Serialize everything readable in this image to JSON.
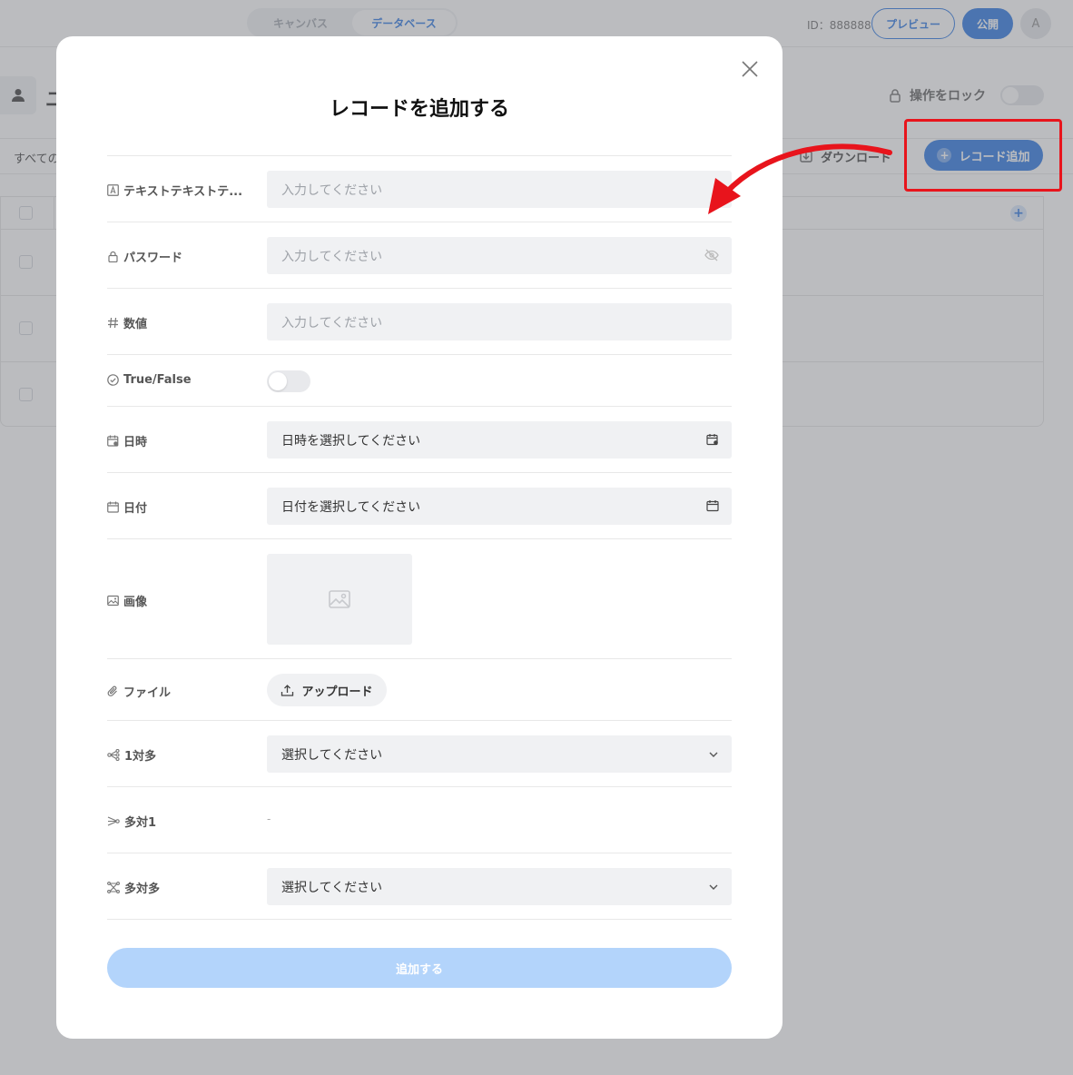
{
  "topbar": {
    "tabs": [
      {
        "label": "キャンバス"
      },
      {
        "label": "データベース"
      }
    ],
    "id_text": "ID：888888",
    "preview_label": "プレビュー",
    "publish_label": "公開",
    "avatar_initial": "A"
  },
  "page": {
    "title": "ユ",
    "lock_label": "操作をロック",
    "filter_label": "すべての",
    "download_label": "ダウンロード",
    "add_record_label": "レコード追加"
  },
  "modal": {
    "title": "レコードを追加する",
    "fields": {
      "text": {
        "label": "テキストテキストテ...",
        "placeholder": "入力してください"
      },
      "password": {
        "label": "パスワード",
        "placeholder": "入力してください"
      },
      "number": {
        "label": "数値",
        "placeholder": "入力してください"
      },
      "boolean": {
        "label": "True/False",
        "value": false
      },
      "datetime": {
        "label": "日時",
        "placeholder": "日時を選択してください"
      },
      "date": {
        "label": "日付",
        "placeholder": "日付を選択してください"
      },
      "image": {
        "label": "画像"
      },
      "file": {
        "label": "ファイル",
        "button": "アップロード"
      },
      "one_to_many": {
        "label": "1対多",
        "placeholder": "選択してください"
      },
      "many_to_one": {
        "label": "多対1",
        "value": "-"
      },
      "many_to_many": {
        "label": "多対多",
        "placeholder": "選択してください"
      }
    },
    "submit_label": "追加する"
  },
  "colors": {
    "accent": "#1f6fe0",
    "highlight": "#e8141c",
    "submit_disabled": "#b3d4fb"
  }
}
